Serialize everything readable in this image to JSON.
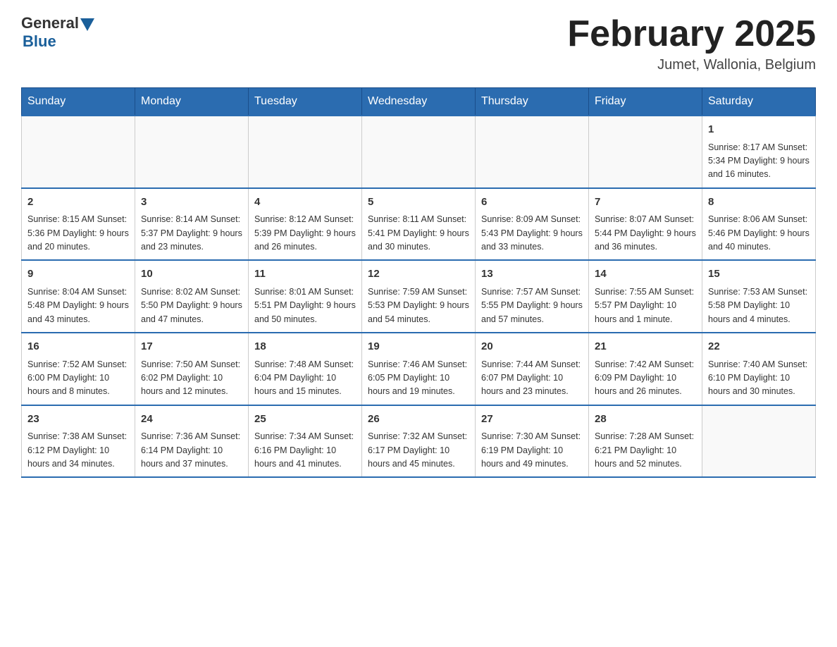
{
  "header": {
    "logo": {
      "general_text": "General",
      "blue_text": "Blue"
    },
    "title": "February 2025",
    "location": "Jumet, Wallonia, Belgium"
  },
  "weekdays": [
    "Sunday",
    "Monday",
    "Tuesday",
    "Wednesday",
    "Thursday",
    "Friday",
    "Saturday"
  ],
  "weeks": [
    [
      {
        "day": "",
        "info": ""
      },
      {
        "day": "",
        "info": ""
      },
      {
        "day": "",
        "info": ""
      },
      {
        "day": "",
        "info": ""
      },
      {
        "day": "",
        "info": ""
      },
      {
        "day": "",
        "info": ""
      },
      {
        "day": "1",
        "info": "Sunrise: 8:17 AM\nSunset: 5:34 PM\nDaylight: 9 hours and 16 minutes."
      }
    ],
    [
      {
        "day": "2",
        "info": "Sunrise: 8:15 AM\nSunset: 5:36 PM\nDaylight: 9 hours and 20 minutes."
      },
      {
        "day": "3",
        "info": "Sunrise: 8:14 AM\nSunset: 5:37 PM\nDaylight: 9 hours and 23 minutes."
      },
      {
        "day": "4",
        "info": "Sunrise: 8:12 AM\nSunset: 5:39 PM\nDaylight: 9 hours and 26 minutes."
      },
      {
        "day": "5",
        "info": "Sunrise: 8:11 AM\nSunset: 5:41 PM\nDaylight: 9 hours and 30 minutes."
      },
      {
        "day": "6",
        "info": "Sunrise: 8:09 AM\nSunset: 5:43 PM\nDaylight: 9 hours and 33 minutes."
      },
      {
        "day": "7",
        "info": "Sunrise: 8:07 AM\nSunset: 5:44 PM\nDaylight: 9 hours and 36 minutes."
      },
      {
        "day": "8",
        "info": "Sunrise: 8:06 AM\nSunset: 5:46 PM\nDaylight: 9 hours and 40 minutes."
      }
    ],
    [
      {
        "day": "9",
        "info": "Sunrise: 8:04 AM\nSunset: 5:48 PM\nDaylight: 9 hours and 43 minutes."
      },
      {
        "day": "10",
        "info": "Sunrise: 8:02 AM\nSunset: 5:50 PM\nDaylight: 9 hours and 47 minutes."
      },
      {
        "day": "11",
        "info": "Sunrise: 8:01 AM\nSunset: 5:51 PM\nDaylight: 9 hours and 50 minutes."
      },
      {
        "day": "12",
        "info": "Sunrise: 7:59 AM\nSunset: 5:53 PM\nDaylight: 9 hours and 54 minutes."
      },
      {
        "day": "13",
        "info": "Sunrise: 7:57 AM\nSunset: 5:55 PM\nDaylight: 9 hours and 57 minutes."
      },
      {
        "day": "14",
        "info": "Sunrise: 7:55 AM\nSunset: 5:57 PM\nDaylight: 10 hours and 1 minute."
      },
      {
        "day": "15",
        "info": "Sunrise: 7:53 AM\nSunset: 5:58 PM\nDaylight: 10 hours and 4 minutes."
      }
    ],
    [
      {
        "day": "16",
        "info": "Sunrise: 7:52 AM\nSunset: 6:00 PM\nDaylight: 10 hours and 8 minutes."
      },
      {
        "day": "17",
        "info": "Sunrise: 7:50 AM\nSunset: 6:02 PM\nDaylight: 10 hours and 12 minutes."
      },
      {
        "day": "18",
        "info": "Sunrise: 7:48 AM\nSunset: 6:04 PM\nDaylight: 10 hours and 15 minutes."
      },
      {
        "day": "19",
        "info": "Sunrise: 7:46 AM\nSunset: 6:05 PM\nDaylight: 10 hours and 19 minutes."
      },
      {
        "day": "20",
        "info": "Sunrise: 7:44 AM\nSunset: 6:07 PM\nDaylight: 10 hours and 23 minutes."
      },
      {
        "day": "21",
        "info": "Sunrise: 7:42 AM\nSunset: 6:09 PM\nDaylight: 10 hours and 26 minutes."
      },
      {
        "day": "22",
        "info": "Sunrise: 7:40 AM\nSunset: 6:10 PM\nDaylight: 10 hours and 30 minutes."
      }
    ],
    [
      {
        "day": "23",
        "info": "Sunrise: 7:38 AM\nSunset: 6:12 PM\nDaylight: 10 hours and 34 minutes."
      },
      {
        "day": "24",
        "info": "Sunrise: 7:36 AM\nSunset: 6:14 PM\nDaylight: 10 hours and 37 minutes."
      },
      {
        "day": "25",
        "info": "Sunrise: 7:34 AM\nSunset: 6:16 PM\nDaylight: 10 hours and 41 minutes."
      },
      {
        "day": "26",
        "info": "Sunrise: 7:32 AM\nSunset: 6:17 PM\nDaylight: 10 hours and 45 minutes."
      },
      {
        "day": "27",
        "info": "Sunrise: 7:30 AM\nSunset: 6:19 PM\nDaylight: 10 hours and 49 minutes."
      },
      {
        "day": "28",
        "info": "Sunrise: 7:28 AM\nSunset: 6:21 PM\nDaylight: 10 hours and 52 minutes."
      },
      {
        "day": "",
        "info": ""
      }
    ]
  ]
}
